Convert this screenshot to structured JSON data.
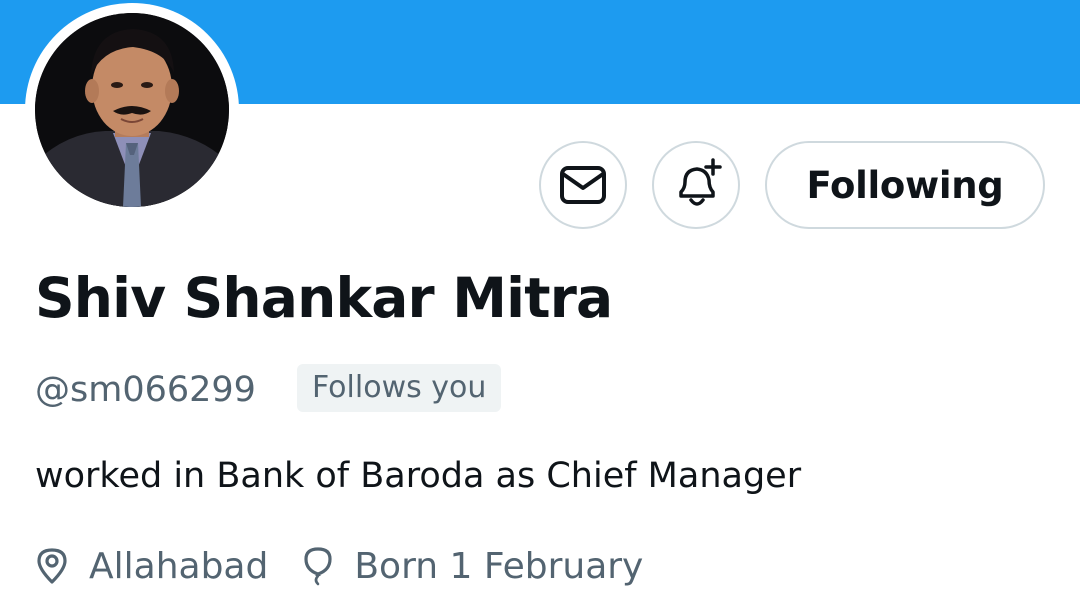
{
  "header": {
    "banner_color": "#1d9bf0"
  },
  "avatar": {
    "alt": "Shiv Shankar Mitra profile photo"
  },
  "actions": {
    "message_icon": "envelope-icon",
    "notify_icon": "bell-plus-icon",
    "following_label": "Following"
  },
  "profile": {
    "display_name": "Shiv Shankar Mitra",
    "handle": "@sm066299",
    "follows_you_label": "Follows you",
    "bio": "worked in Bank of Baroda as Chief Manager",
    "location": "Allahabad",
    "location_icon": "location-pin-icon",
    "birthday": "Born 1 February",
    "birthday_icon": "balloon-icon"
  },
  "colors": {
    "text_primary": "#0f1419",
    "text_secondary": "#536471",
    "border": "#cfd9de",
    "badge_bg": "#eff3f4"
  }
}
